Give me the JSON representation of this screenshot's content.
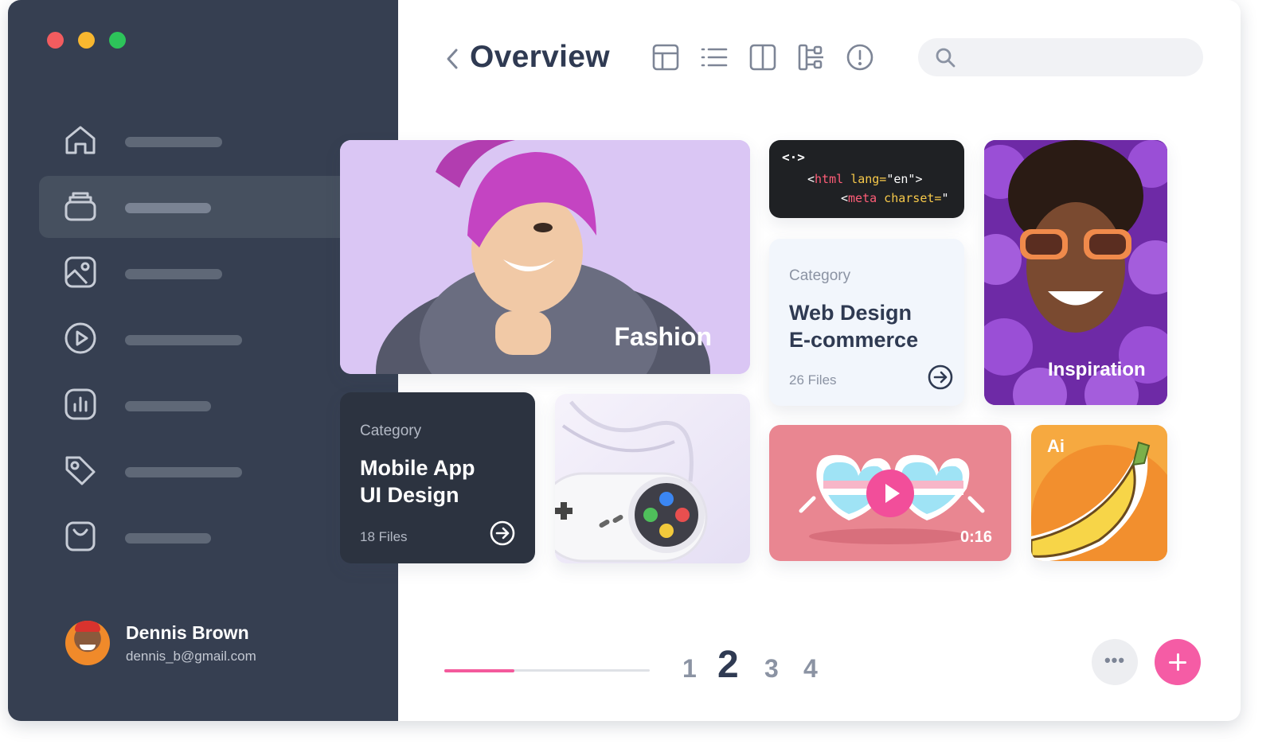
{
  "header": {
    "title": "Overview",
    "search_placeholder": ""
  },
  "cards": {
    "fashion": {
      "label": "Fashion"
    },
    "code": {
      "line1_open": "<",
      "line1_tag": "html",
      "line1_attr": " lang=",
      "line1_val": "\"en\"",
      "line1_close": ">",
      "line2_open": "<",
      "line2_tag": "meta",
      "line2_attr": " charset=",
      "line2_val": "\""
    },
    "web_design": {
      "category": "Category",
      "title_line1": "Web Design",
      "title_line2": "E-commerce",
      "files": "26 Files"
    },
    "inspiration": {
      "label": "Inspiration"
    },
    "mobile_app": {
      "category": "Category",
      "title_line1": "Mobile App",
      "title_line2": "UI Design",
      "files": "18 Files"
    },
    "video": {
      "duration": "0:16"
    },
    "ai": {
      "label": "Ai"
    }
  },
  "pagination": {
    "pages": [
      "1",
      "2",
      "3",
      "4"
    ],
    "current": "2",
    "progress_fraction": 0.34
  },
  "user": {
    "name": "Dennis Brown",
    "email": "dennis_b@gmail.com"
  },
  "sidebar": {
    "items": [
      {
        "icon": "home-icon"
      },
      {
        "icon": "archive-icon",
        "active": true
      },
      {
        "icon": "image-icon"
      },
      {
        "icon": "play-circle-icon"
      },
      {
        "icon": "chart-icon"
      },
      {
        "icon": "tag-icon"
      },
      {
        "icon": "shopping-bag-icon"
      }
    ]
  },
  "colors": {
    "sidebar": "#363f51",
    "accent": "#f55ca5",
    "title": "#2f3a52"
  }
}
